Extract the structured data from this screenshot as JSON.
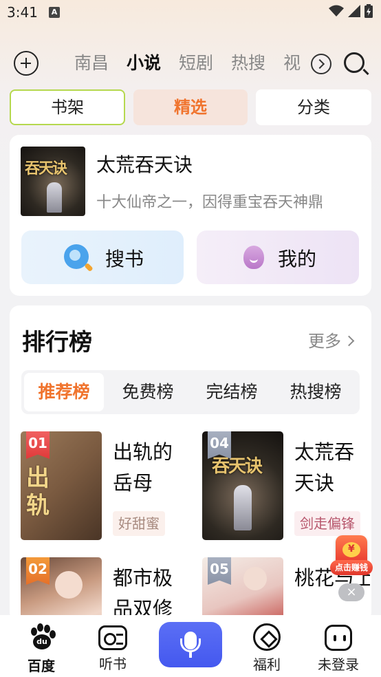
{
  "status_bar": {
    "time": "3:41",
    "notif_icon": "A"
  },
  "nav": {
    "tabs": [
      "南昌",
      "小说",
      "短剧",
      "热搜",
      "视"
    ],
    "active_tab": "小说"
  },
  "segments": {
    "shelf": "书架",
    "pick": "精选",
    "category": "分类"
  },
  "featured": {
    "title": "太荒吞天诀",
    "desc": "十大仙帝之一，因得重宝吞天神鼎",
    "cover_text": "吞天诀",
    "search_label": "搜书",
    "mine_label": "我的"
  },
  "ranking": {
    "title": "排行榜",
    "more": "更多",
    "tabs": [
      "推荐榜",
      "免费榜",
      "完结榜",
      "热搜榜"
    ],
    "books": [
      {
        "rank": "01",
        "name": "出轨的岳母",
        "tag": "好甜蜜",
        "cover_text": "出轨"
      },
      {
        "rank": "04",
        "name": "太荒吞天诀",
        "tag": "剑走偏锋",
        "cover_text": "吞天诀"
      },
      {
        "rank": "02",
        "name": "都市极品双修",
        "tag": "",
        "cover_text": ""
      },
      {
        "rank": "05",
        "name": "桃花与上请",
        "tag": "",
        "cover_text": ""
      }
    ]
  },
  "float": {
    "label": "点击赚钱",
    "coin": "¥"
  },
  "bottom_nav": {
    "baidu": "百度",
    "listen": "听书",
    "welfare": "福利",
    "login": "未登录",
    "baidu_mark": "du"
  }
}
